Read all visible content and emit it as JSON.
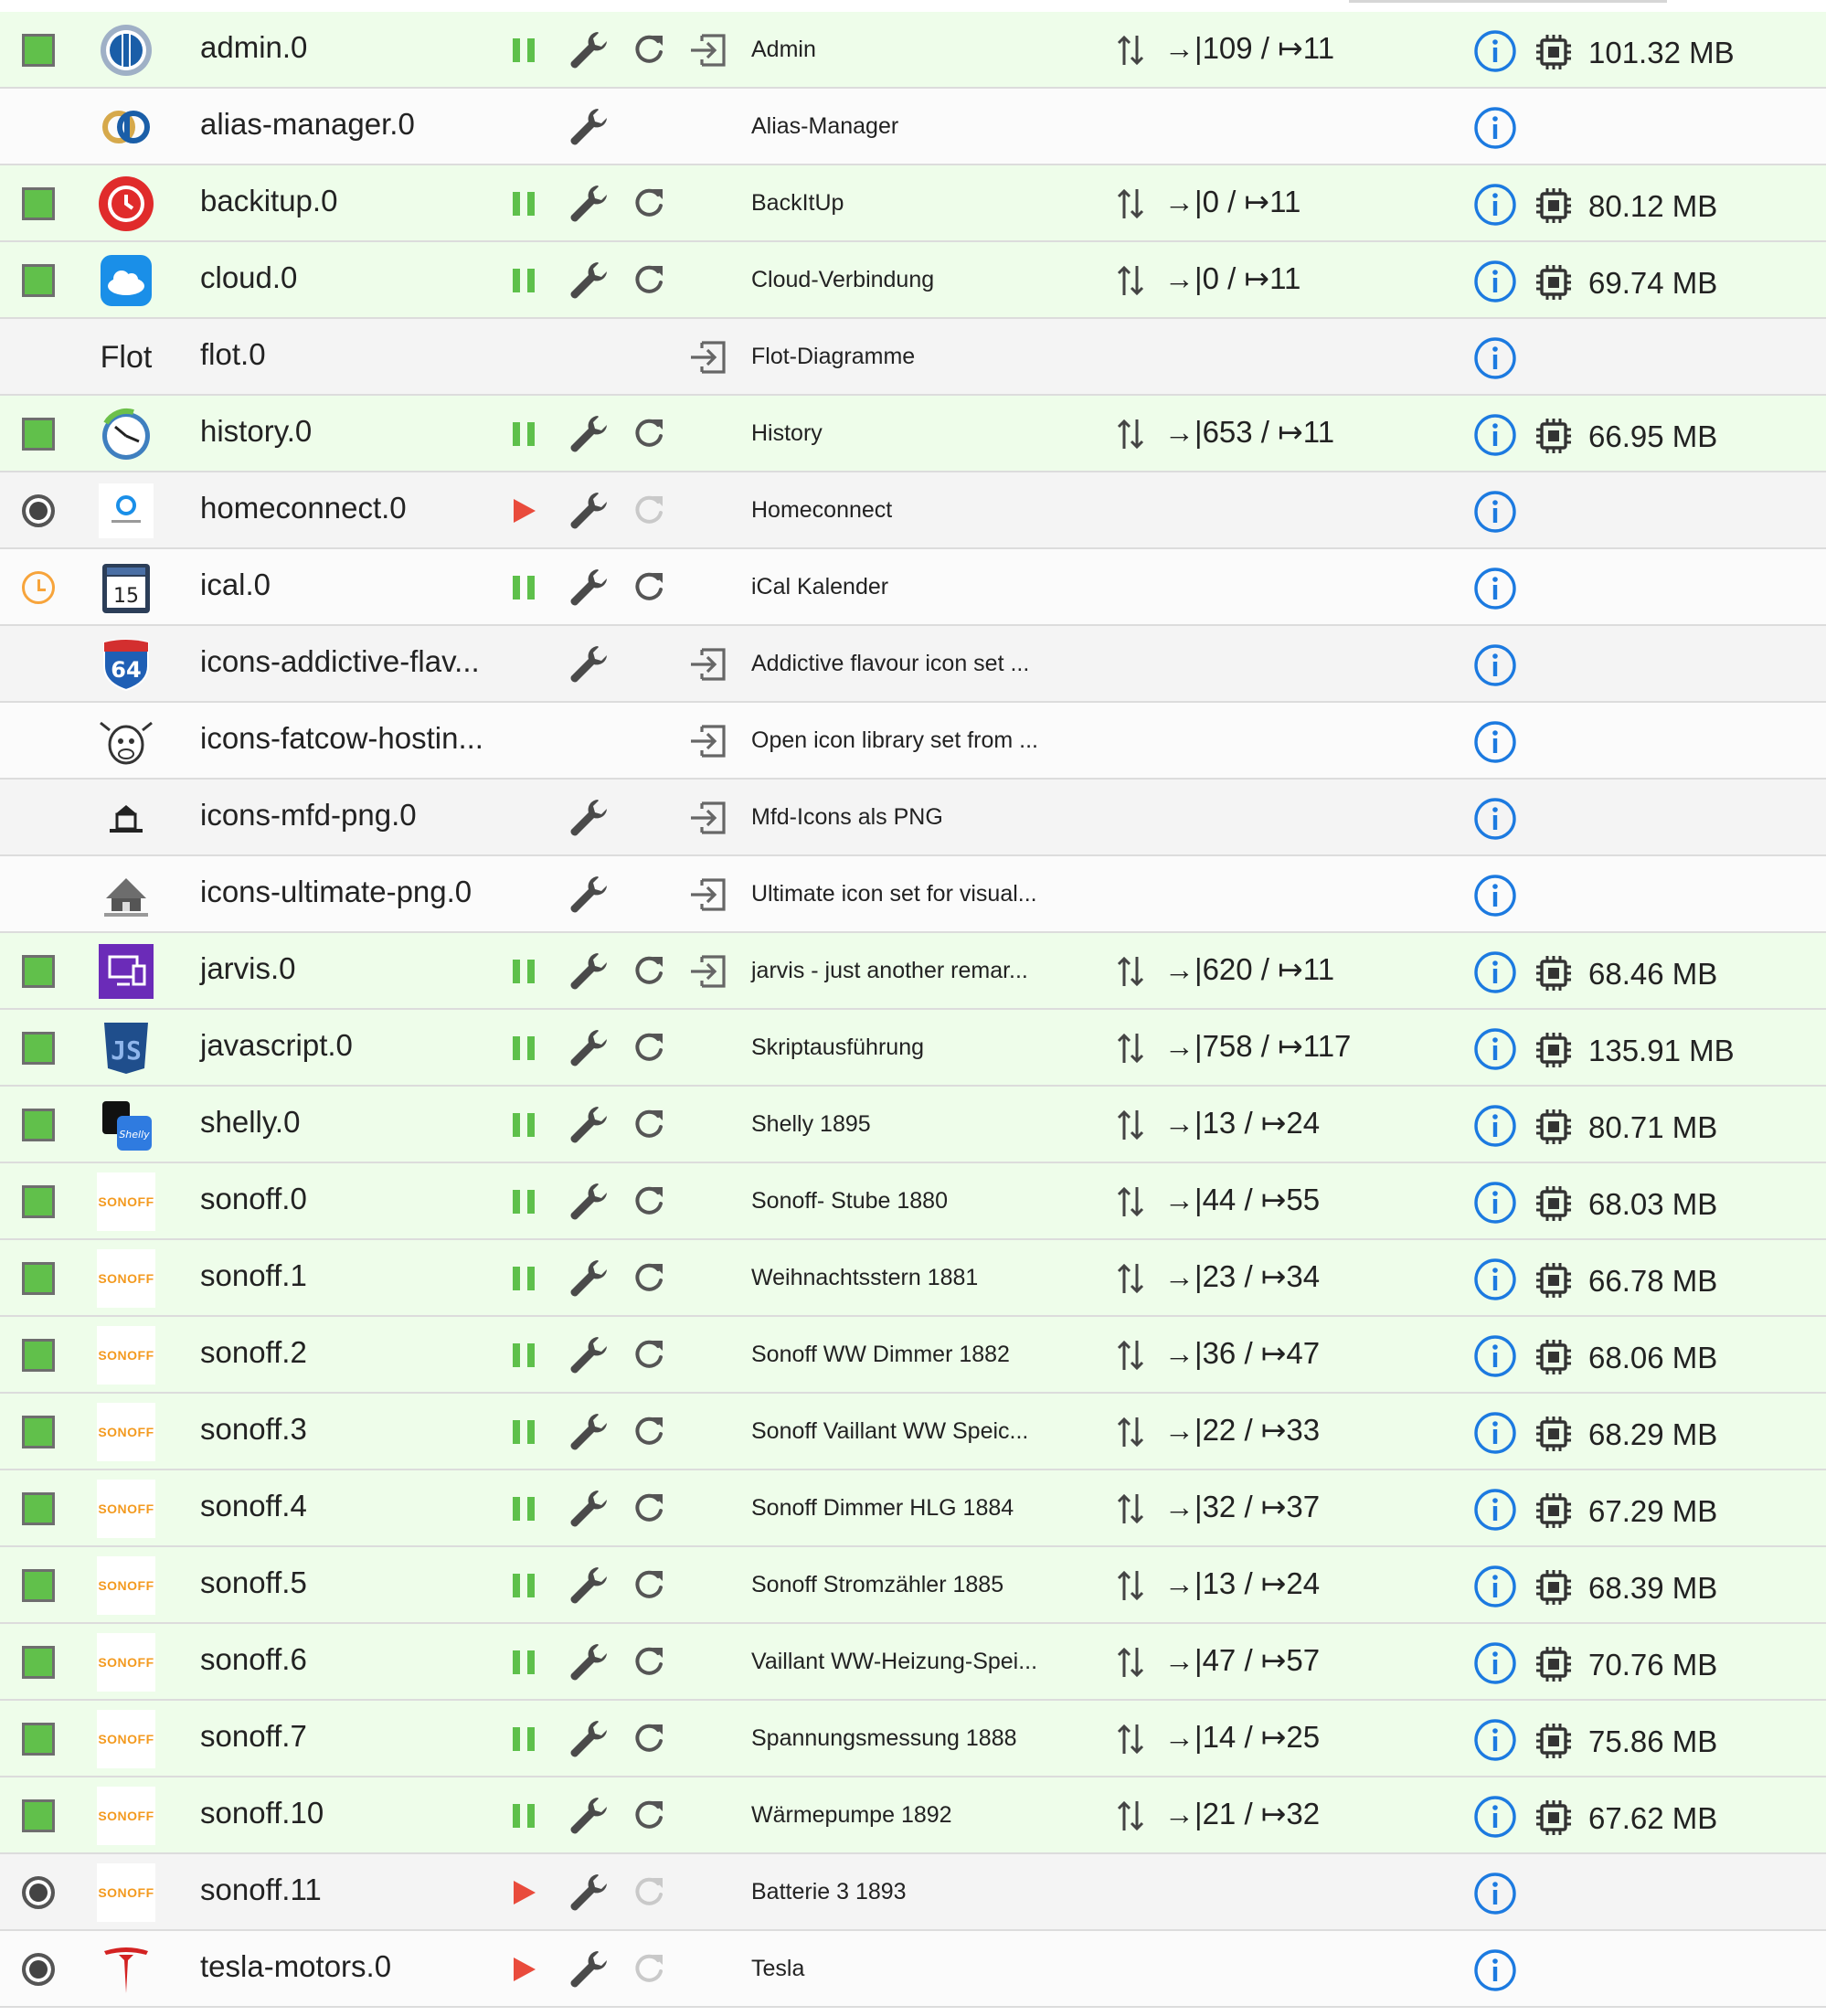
{
  "colors": {
    "running_row": "#eefdea",
    "stopped_row": "#f4f4f4",
    "status_green": "#61c04b",
    "play_red": "#e94b3c",
    "pause_green": "#5ec04b",
    "info_blue": "#1c7ae0"
  },
  "rows": [
    {
      "name": "admin.0",
      "title": "Admin",
      "status": "green",
      "logo": "admin-logo-icon",
      "pause": true,
      "play": false,
      "wrench": true,
      "reload": "active",
      "login": true,
      "events": "→|109 / ↦11",
      "memory": "101.32 MB"
    },
    {
      "name": "alias-manager.0",
      "title": "Alias-Manager",
      "status": "none",
      "logo": "alias-manager-logo-icon",
      "pause": false,
      "play": false,
      "wrench": true,
      "reload": "none",
      "login": false,
      "events": "",
      "memory": ""
    },
    {
      "name": "backitup.0",
      "title": "BackItUp",
      "status": "green",
      "logo": "backitup-logo-icon",
      "pause": true,
      "play": false,
      "wrench": true,
      "reload": "active",
      "login": false,
      "events": "→|0 / ↦11",
      "memory": "80.12 MB"
    },
    {
      "name": "cloud.0",
      "title": "Cloud-Verbindung",
      "status": "green",
      "logo": "cloud-logo-icon",
      "pause": true,
      "play": false,
      "wrench": true,
      "reload": "active",
      "login": false,
      "events": "→|0 / ↦11",
      "memory": "69.74 MB"
    },
    {
      "name": "flot.0",
      "title": "Flot-Diagramme",
      "status": "none",
      "logo": "flot-logo-icon",
      "logo_text": "Flot",
      "pause": false,
      "play": false,
      "wrench": false,
      "reload": "none",
      "login": true,
      "events": "",
      "memory": ""
    },
    {
      "name": "history.0",
      "title": "History",
      "status": "green",
      "logo": "history-logo-icon",
      "pause": true,
      "play": false,
      "wrench": true,
      "reload": "active",
      "login": false,
      "events": "→|653 / ↦11",
      "memory": "66.95 MB"
    },
    {
      "name": "homeconnect.0",
      "title": "Homeconnect",
      "status": "off",
      "logo": "homeconnect-logo-icon",
      "pause": false,
      "play": true,
      "wrench": true,
      "reload": "dim",
      "login": false,
      "events": "",
      "memory": ""
    },
    {
      "name": "ical.0",
      "title": "iCal Kalender",
      "status": "clock",
      "logo": "ical-logo-icon",
      "pause": true,
      "play": false,
      "wrench": true,
      "reload": "active",
      "login": false,
      "events": "",
      "memory": ""
    },
    {
      "name": "icons-addictive-flav...",
      "title": "Addictive flavour icon set ...",
      "status": "none",
      "logo": "icons-addictive-logo-icon",
      "pause": false,
      "play": false,
      "wrench": true,
      "reload": "none",
      "login": true,
      "events": "",
      "memory": ""
    },
    {
      "name": "icons-fatcow-hostin...",
      "title": "Open icon library set from ...",
      "status": "none",
      "logo": "icons-fatcow-logo-icon",
      "pause": false,
      "play": false,
      "wrench": false,
      "reload": "none",
      "login": true,
      "events": "",
      "memory": ""
    },
    {
      "name": "icons-mfd-png.0",
      "title": "Mfd-Icons als PNG",
      "status": "none",
      "logo": "icons-mfd-logo-icon",
      "pause": false,
      "play": false,
      "wrench": true,
      "reload": "none",
      "login": true,
      "events": "",
      "memory": ""
    },
    {
      "name": "icons-ultimate-png.0",
      "title": "Ultimate icon set for visual...",
      "status": "none",
      "logo": "icons-ultimate-logo-icon",
      "pause": false,
      "play": false,
      "wrench": true,
      "reload": "none",
      "login": true,
      "events": "",
      "memory": ""
    },
    {
      "name": "jarvis.0",
      "title": "jarvis - just another remar...",
      "status": "green",
      "logo": "jarvis-logo-icon",
      "pause": true,
      "play": false,
      "wrench": true,
      "reload": "active",
      "login": true,
      "events": "→|620 / ↦11",
      "memory": "68.46 MB"
    },
    {
      "name": "javascript.0",
      "title": "Skriptausführung",
      "status": "green",
      "logo": "javascript-logo-icon",
      "pause": true,
      "play": false,
      "wrench": true,
      "reload": "active",
      "login": false,
      "events": "→|758 / ↦117",
      "memory": "135.91 MB"
    },
    {
      "name": "shelly.0",
      "title": "Shelly 1895",
      "status": "green",
      "logo": "shelly-logo-icon",
      "pause": true,
      "play": false,
      "wrench": true,
      "reload": "active",
      "login": false,
      "events": "→|13 / ↦24",
      "memory": "80.71 MB"
    },
    {
      "name": "sonoff.0",
      "title": "Sonoff- Stube 1880",
      "status": "green",
      "logo": "sonoff-logo-icon",
      "logo_text": "SONOFF",
      "pause": true,
      "play": false,
      "wrench": true,
      "reload": "active",
      "login": false,
      "events": "→|44 / ↦55",
      "memory": "68.03 MB"
    },
    {
      "name": "sonoff.1",
      "title": "Weihnachtsstern 1881",
      "status": "green",
      "logo": "sonoff-logo-icon",
      "logo_text": "SONOFF",
      "pause": true,
      "play": false,
      "wrench": true,
      "reload": "active",
      "login": false,
      "events": "→|23 / ↦34",
      "memory": "66.78 MB"
    },
    {
      "name": "sonoff.2",
      "title": "Sonoff WW Dimmer 1882",
      "status": "green",
      "logo": "sonoff-logo-icon",
      "logo_text": "SONOFF",
      "pause": true,
      "play": false,
      "wrench": true,
      "reload": "active",
      "login": false,
      "events": "→|36 / ↦47",
      "memory": "68.06 MB"
    },
    {
      "name": "sonoff.3",
      "title": "Sonoff Vaillant WW Speic...",
      "status": "green",
      "logo": "sonoff-logo-icon",
      "logo_text": "SONOFF",
      "pause": true,
      "play": false,
      "wrench": true,
      "reload": "active",
      "login": false,
      "events": "→|22 / ↦33",
      "memory": "68.29 MB"
    },
    {
      "name": "sonoff.4",
      "title": "Sonoff Dimmer HLG 1884",
      "status": "green",
      "logo": "sonoff-logo-icon",
      "logo_text": "SONOFF",
      "pause": true,
      "play": false,
      "wrench": true,
      "reload": "active",
      "login": false,
      "events": "→|32 / ↦37",
      "memory": "67.29 MB"
    },
    {
      "name": "sonoff.5",
      "title": "Sonoff Stromzähler 1885",
      "status": "green",
      "logo": "sonoff-logo-icon",
      "logo_text": "SONOFF",
      "pause": true,
      "play": false,
      "wrench": true,
      "reload": "active",
      "login": false,
      "events": "→|13 / ↦24",
      "memory": "68.39 MB"
    },
    {
      "name": "sonoff.6",
      "title": "Vaillant WW-Heizung-Spei...",
      "status": "green",
      "logo": "sonoff-logo-icon",
      "logo_text": "SONOFF",
      "pause": true,
      "play": false,
      "wrench": true,
      "reload": "active",
      "login": false,
      "events": "→|47 / ↦57",
      "memory": "70.76 MB"
    },
    {
      "name": "sonoff.7",
      "title": "Spannungsmessung 1888",
      "status": "green",
      "logo": "sonoff-logo-icon",
      "logo_text": "SONOFF",
      "pause": true,
      "play": false,
      "wrench": true,
      "reload": "active",
      "login": false,
      "events": "→|14 / ↦25",
      "memory": "75.86 MB"
    },
    {
      "name": "sonoff.10",
      "title": "Wärmepumpe 1892",
      "status": "green",
      "logo": "sonoff-logo-icon",
      "logo_text": "SONOFF",
      "pause": true,
      "play": false,
      "wrench": true,
      "reload": "active",
      "login": false,
      "events": "→|21 / ↦32",
      "memory": "67.62 MB"
    },
    {
      "name": "sonoff.11",
      "title": "Batterie 3 1893",
      "status": "off",
      "logo": "sonoff-logo-icon",
      "logo_text": "SONOFF",
      "pause": false,
      "play": true,
      "wrench": true,
      "reload": "dim",
      "login": false,
      "events": "",
      "memory": ""
    },
    {
      "name": "tesla-motors.0",
      "title": "Tesla",
      "status": "off",
      "logo": "tesla-logo-icon",
      "pause": false,
      "play": true,
      "wrench": true,
      "reload": "dim",
      "login": false,
      "events": "",
      "memory": ""
    }
  ]
}
